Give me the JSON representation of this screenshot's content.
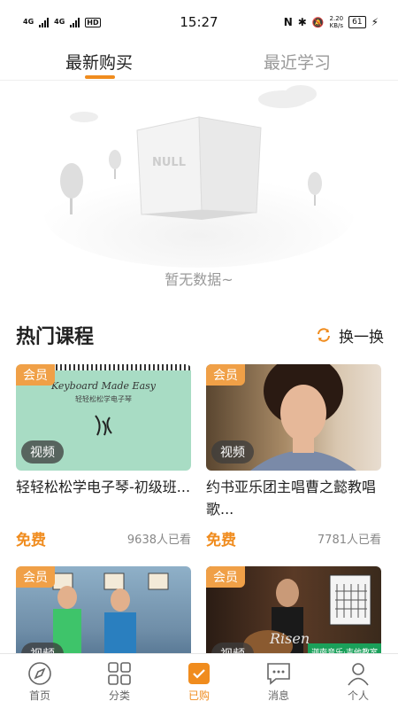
{
  "status_bar": {
    "net1": "4G",
    "net2": "4G",
    "hd": "HD",
    "time": "15:27",
    "speed_value": "2.20",
    "speed_unit": "KB/s",
    "battery": "61"
  },
  "tabs": [
    {
      "label": "最新购买",
      "active": true
    },
    {
      "label": "最近学习",
      "active": false
    }
  ],
  "empty_state": {
    "book_label": "NULL",
    "message": "暂无数据~"
  },
  "hot": {
    "title": "热门课程",
    "refresh_label": "换一换"
  },
  "courses": [
    {
      "vip": "会员",
      "video": "视频",
      "title": "轻轻松松学电子琴-初级班...",
      "price": "免费",
      "views": "9638人已看",
      "cover_title": "Keyboard Made Easy",
      "cover_subtitle": "轻轻松松学电子琴"
    },
    {
      "vip": "会员",
      "video": "视频",
      "title": "约书亚乐团主唱曹之懿教唱歌...",
      "price": "免费",
      "views": "7781人已看"
    },
    {
      "vip": "会员",
      "video": "视频",
      "title": "",
      "price": "",
      "views": ""
    },
    {
      "vip": "会员",
      "video": "视频",
      "title": "",
      "price": "",
      "views": "",
      "cover_word": "Risen",
      "cover_tag": "迦南音乐·吉他教室"
    }
  ],
  "bottom_nav": [
    {
      "label": "首页",
      "icon": "compass-icon",
      "active": false
    },
    {
      "label": "分类",
      "icon": "grid-icon",
      "active": false
    },
    {
      "label": "已购",
      "icon": "purchased-icon",
      "active": true
    },
    {
      "label": "消息",
      "icon": "message-icon",
      "active": false
    },
    {
      "label": "个人",
      "icon": "person-icon",
      "active": false
    }
  ],
  "colors": {
    "accent": "#f08c1e",
    "vip_badge": "#f0a047",
    "cover_green": "#a8dcc4"
  }
}
